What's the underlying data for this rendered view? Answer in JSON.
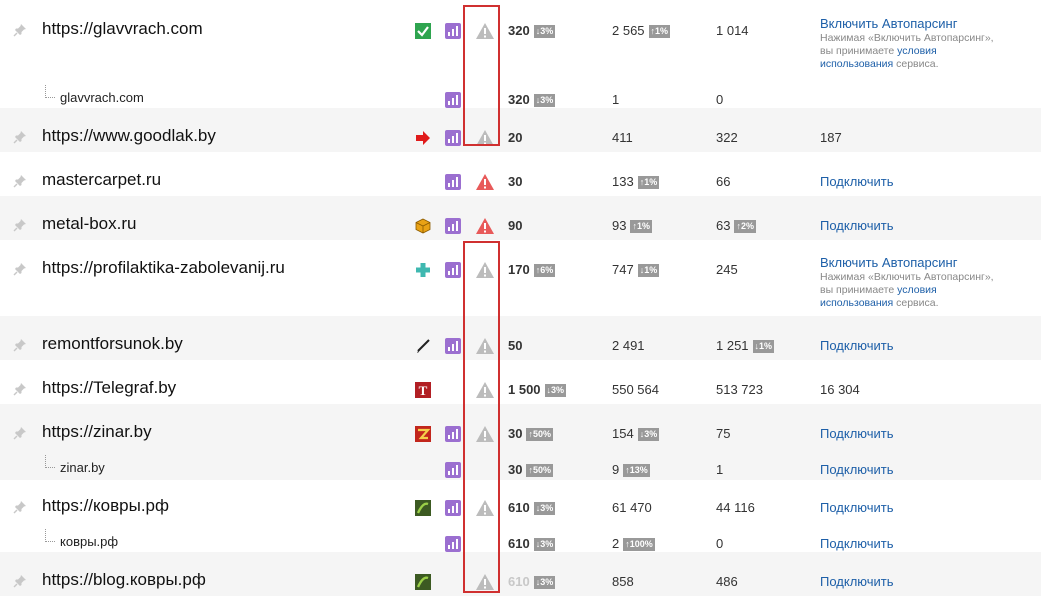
{
  "colors": {
    "highlight": "#d03030",
    "link": "#1d5fa8",
    "warn_red": "#e85a5a",
    "warn_gray": "#bcbcbc",
    "badge": "#999999"
  },
  "autoparsing": {
    "enable_label": "Включить Автопарсинг",
    "note_prefix": "Нажимая «Включить Автопарсинг»,",
    "note_middle": "вы принимаете",
    "terms_link_1": "условия",
    "terms_link_2": "использования",
    "note_suffix": "сервиса."
  },
  "rows": [
    {
      "title": "https://glavvrach.com",
      "favicon": "checkmark-icon",
      "warning": "gray",
      "cy": "320",
      "cy_badge": "↓3%",
      "col2": "2 565",
      "col2_badge": "↑1%",
      "col3": "1 014",
      "action": "autoparsing"
    },
    {
      "sub": true,
      "title": "glavvrach.com",
      "cy": "320",
      "cy_badge": "↓3%",
      "col2": "1",
      "col3": "0"
    },
    {
      "title": "https://www.goodlak.by",
      "favicon": "red-arrow-icon",
      "warning": "gray",
      "cy": "20",
      "col2": "411",
      "col3": "322",
      "col4": "187"
    },
    {
      "title": "mastercarpet.ru",
      "warning": "red",
      "cy": "30",
      "col2": "133",
      "col2_badge": "↑1%",
      "col3": "66",
      "action_label": "Подключить"
    },
    {
      "title": "metal-box.ru",
      "favicon": "cube-icon",
      "warning": "red",
      "cy": "90",
      "col2": "93",
      "col2_badge": "↑1%",
      "col3": "63",
      "col3_badge": "↑2%",
      "action_label": "Подключить"
    },
    {
      "title": "https://profilaktika-zabolevanij.ru",
      "favicon": "medical-cross-icon",
      "warning": "gray",
      "cy": "170",
      "cy_badge": "↑6%",
      "col2": "747",
      "col2_badge": "↓1%",
      "col3": "245",
      "action": "autoparsing"
    },
    {
      "title": "remontforsunok.by",
      "favicon": "pen-icon",
      "warning": "gray",
      "cy": "50",
      "col2": "2 491",
      "col3": "1 251",
      "col3_badge": "↓1%",
      "action_label": "Подключить"
    },
    {
      "title": "https://Telegraf.by",
      "favicon": "letter-t-icon",
      "favicon_letter": "T",
      "warning": "gray",
      "cy": "1 500",
      "cy_badge": "↓3%",
      "col2": "550 564",
      "col3": "513 723",
      "col4": "16 304"
    },
    {
      "title": "https://zinar.by",
      "favicon": "zinar-logo-icon",
      "warning": "gray",
      "cy": "30",
      "cy_badge": "↑50%",
      "col2": "154",
      "col2_badge": "↓3%",
      "col3": "75",
      "action_label": "Подключить"
    },
    {
      "sub": true,
      "title": "zinar.by",
      "cy": "30",
      "cy_badge": "↑50%",
      "col2": "9",
      "col2_badge": "↑13%",
      "col3": "1",
      "action_label": "Подключить"
    },
    {
      "title": "https://ковры.рф",
      "favicon": "carpet-icon",
      "warning": "gray",
      "cy": "610",
      "cy_badge": "↓3%",
      "col2": "61 470",
      "col3": "44 116",
      "action_label": "Подключить"
    },
    {
      "sub": true,
      "title": "ковры.рф",
      "cy": "610",
      "cy_badge": "↓3%",
      "col2": "2",
      "col2_badge": "↑100%",
      "col3": "0",
      "action_label": "Подключить"
    },
    {
      "title": "https://blog.ковры.рф",
      "favicon": "carpet-icon",
      "warning": "gray",
      "cy": "610",
      "cy_muted": true,
      "cy_badge": "↓3%",
      "col2": "858",
      "col3": "486",
      "action_label": "Подключить"
    }
  ]
}
